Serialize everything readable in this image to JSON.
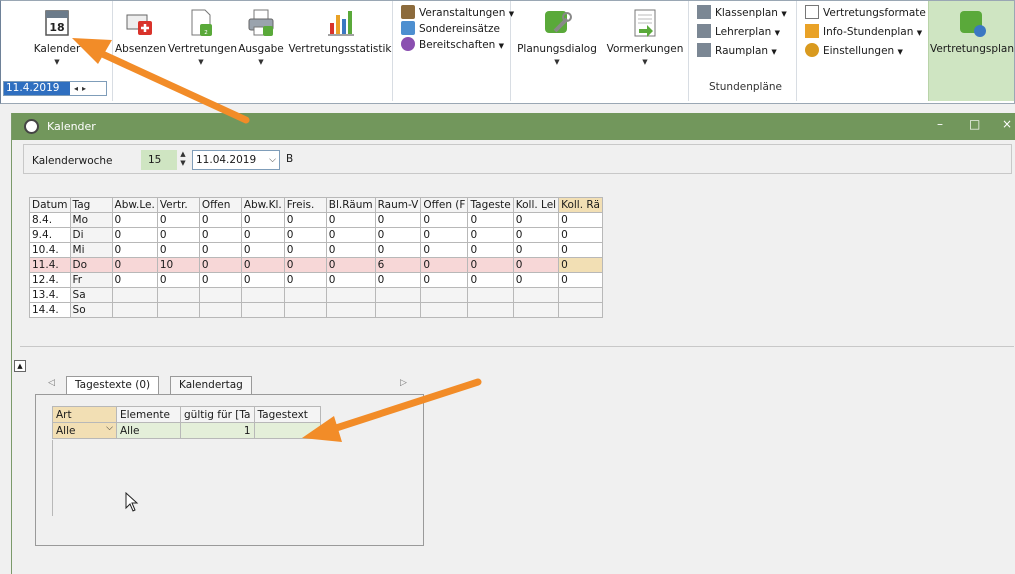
{
  "ribbon": {
    "kalender": {
      "label": "Kalender",
      "day": "18",
      "date": "11.4.2019"
    },
    "absenzen": "Absenzen",
    "vertretungen": "Vertretungen",
    "ausgabe": "Ausgabe",
    "vertretungsstatistik": "Vertretungsstatistik",
    "veranstaltungen": "Veranstaltungen",
    "sondereinsaetze": "Sondereinsätze",
    "bereitschaften": "Bereitschaften",
    "planungsdialog": "Planungsdialog",
    "vormerkungen": "Vormerkungen",
    "klassenplan": "Klassenplan",
    "lehrerplan": "Lehrerplan",
    "raumplan": "Raumplan",
    "stundenplaene_caption": "Stundenpläne",
    "vertretungsformate": "Vertretungsformate",
    "info_stundenplan": "Info-Stundenplan",
    "einstellungen": "Einstellungen",
    "vertretungsplan": "Vertretungsplan"
  },
  "window": {
    "title": "Kalender",
    "kalenderwoche_label": "Kalenderwoche",
    "kalenderwoche_value": "15",
    "date_value": "11.04.2019",
    "b_label": "B"
  },
  "grid": {
    "headers": [
      "Datum",
      "Tag",
      "Abw.Le.",
      "Vertr.",
      "Offen",
      "Abw.Kl.",
      "Freis.",
      "Bl.Räum",
      "Raum-V",
      "Offen (F",
      "Tageste",
      "Koll. Lel",
      "Koll. Rä"
    ],
    "rows": [
      [
        "8.4.",
        "Mo",
        "0",
        "0",
        "0",
        "0",
        "0",
        "0",
        "0",
        "0",
        "0",
        "0",
        "0"
      ],
      [
        "9.4.",
        "Di",
        "0",
        "0",
        "0",
        "0",
        "0",
        "0",
        "0",
        "0",
        "0",
        "0",
        "0"
      ],
      [
        "10.4.",
        "Mi",
        "0",
        "0",
        "0",
        "0",
        "0",
        "0",
        "0",
        "0",
        "0",
        "0",
        "0"
      ],
      [
        "11.4.",
        "Do",
        "0",
        "10",
        "0",
        "0",
        "0",
        "0",
        "6",
        "0",
        "0",
        "0",
        "0"
      ],
      [
        "12.4.",
        "Fr",
        "0",
        "0",
        "0",
        "0",
        "0",
        "0",
        "0",
        "0",
        "0",
        "0",
        "0"
      ],
      [
        "13.4.",
        "Sa",
        "",
        "",
        "",
        "",
        "",
        "",
        "",
        "",
        "",
        "",
        ""
      ],
      [
        "14.4.",
        "So",
        "",
        "",
        "",
        "",
        "",
        "",
        "",
        "",
        "",
        "",
        ""
      ]
    ]
  },
  "lower": {
    "tab1": "Tagestexte (0)",
    "tab2": "Kalendertag",
    "headers": [
      "Art",
      "Elemente",
      "gültig für [Ta",
      "Tagestext"
    ],
    "row": [
      "Alle",
      "Alle",
      "1",
      ""
    ]
  },
  "colors": {
    "titlebar": "#72975c",
    "highlight_green": "#cfe5c2",
    "row_pink": "#f7d7d7",
    "cell_tan": "#f2dfb4",
    "arrow_orange": "#f28c28"
  }
}
